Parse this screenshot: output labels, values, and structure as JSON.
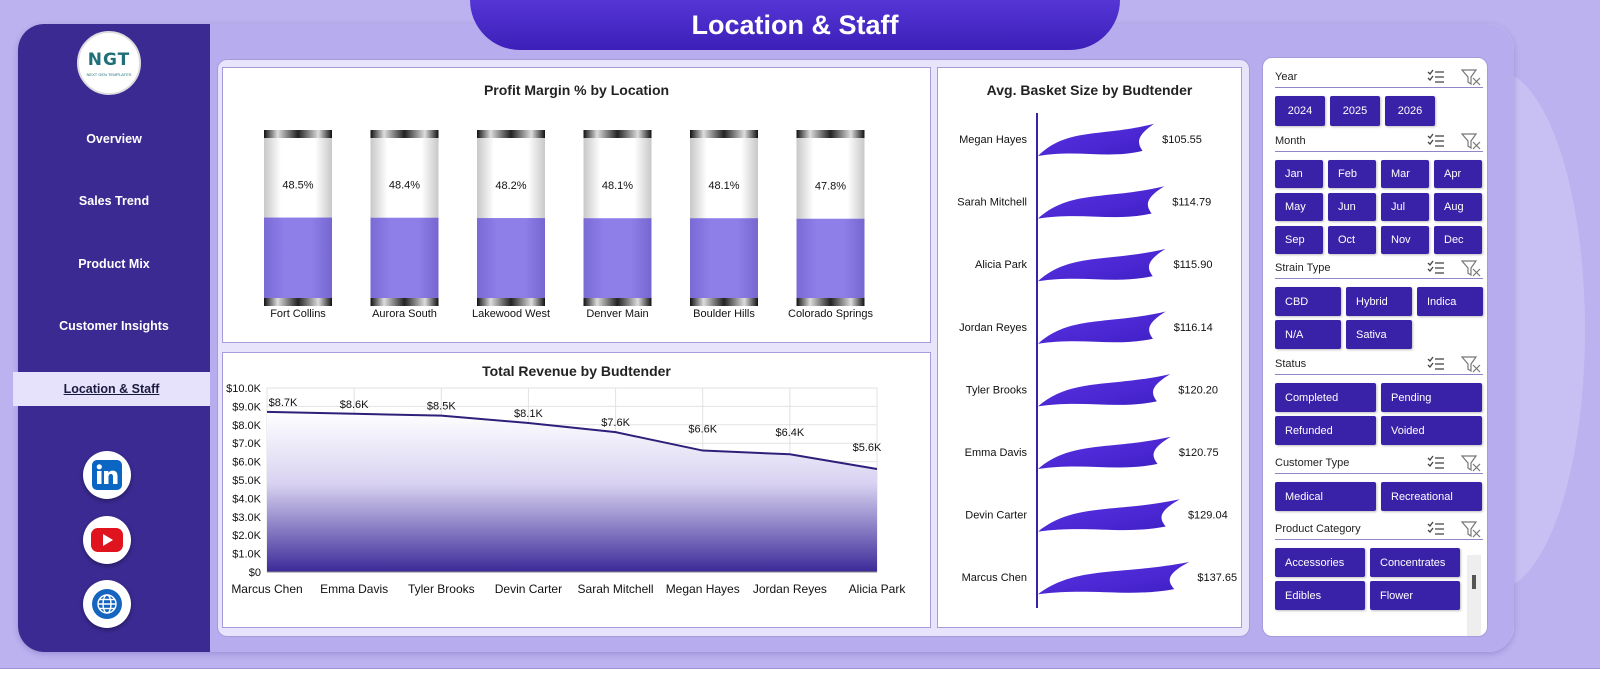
{
  "page": {
    "title": "Location & Staff"
  },
  "logo": {
    "text": "NGT",
    "subtext": "NEXT GEN TEMPLATES"
  },
  "sidebar": {
    "items": [
      {
        "label": "Overview"
      },
      {
        "label": "Sales Trend"
      },
      {
        "label": "Product Mix"
      },
      {
        "label": "Customer Insights"
      },
      {
        "label": "Location & Staff",
        "active": true
      }
    ],
    "social": [
      {
        "icon": "linkedin-icon",
        "color": "#0a66c2"
      },
      {
        "icon": "youtube-icon",
        "color": "#e0141e"
      },
      {
        "icon": "globe-icon",
        "color": "#1565c0"
      }
    ]
  },
  "colors": {
    "accent": "#3a22a8",
    "sidebar": "#3a2a92",
    "fill": "#8878e0",
    "line": "#2e1f7a",
    "flag": "#4a23d6"
  },
  "slicers": [
    {
      "label": "Year",
      "options": [
        "2024",
        "2025",
        "2026"
      ]
    },
    {
      "label": "Month",
      "options": [
        "Jan",
        "Feb",
        "Mar",
        "Apr",
        "May",
        "Jun",
        "Jul",
        "Aug",
        "Sep",
        "Oct",
        "Nov",
        "Dec"
      ]
    },
    {
      "label": "Strain Type",
      "options": [
        "CBD",
        "Hybrid",
        "Indica",
        "N/A",
        "Sativa"
      ]
    },
    {
      "label": "Status",
      "options": [
        "Completed",
        "Pending",
        "Refunded",
        "Voided"
      ]
    },
    {
      "label": "Customer Type",
      "options": [
        "Medical",
        "Recreational"
      ]
    },
    {
      "label": "Product Category",
      "options": [
        "Accessories",
        "Concentrates",
        "Edibles",
        "Flower"
      ]
    }
  ],
  "chart_data": [
    {
      "type": "bar",
      "title": "Profit Margin % by Location",
      "categories": [
        "Fort Collins",
        "Aurora South",
        "Lakewood West",
        "Denver Main",
        "Boulder Hills",
        "Colorado Springs"
      ],
      "values": [
        48.5,
        48.4,
        48.2,
        48.1,
        48.1,
        47.8
      ],
      "data_labels": [
        "48.5%",
        "48.4%",
        "48.2%",
        "48.1%",
        "48.1%",
        "47.8%"
      ],
      "ylim": [
        0,
        100
      ],
      "grid": false,
      "legend": "none"
    },
    {
      "type": "area",
      "title": "Total Revenue  by Budtender",
      "categories": [
        "Marcus Chen",
        "Emma Davis",
        "Tyler Brooks",
        "Devin Carter",
        "Sarah Mitchell",
        "Megan Hayes",
        "Jordan Reyes",
        "Alicia Park"
      ],
      "values": [
        8700,
        8600,
        8500,
        8100,
        7600,
        6600,
        6400,
        5600
      ],
      "data_labels": [
        "$8.7K",
        "$8.6K",
        "$8.5K",
        "$8.1K",
        "$7.6K",
        "$6.6K",
        "$6.4K",
        "$5.6K"
      ],
      "ylim": [
        0,
        10000
      ],
      "yticks": [
        "$0",
        "$1.0K",
        "$2.0K",
        "$3.0K",
        "$4.0K",
        "$5.0K",
        "$6.0K",
        "$7.0K",
        "$8.0K",
        "$9.0K",
        "$10.0K"
      ],
      "grid": true,
      "legend": "none"
    },
    {
      "type": "bar",
      "orientation": "horizontal",
      "title": "Avg. Basket Size by Budtender",
      "categories": [
        "Megan Hayes",
        "Sarah Mitchell",
        "Alicia Park",
        "Jordan Reyes",
        "Tyler Brooks",
        "Emma Davis",
        "Devin Carter",
        "Marcus Chen"
      ],
      "values": [
        105.55,
        114.79,
        115.9,
        116.14,
        120.2,
        120.75,
        129.04,
        137.65
      ],
      "data_labels": [
        "$105.55",
        "$114.79",
        "$115.90",
        "$116.14",
        "$120.20",
        "$120.75",
        "$129.04",
        "$137.65"
      ],
      "grid": false,
      "legend": "none"
    }
  ]
}
